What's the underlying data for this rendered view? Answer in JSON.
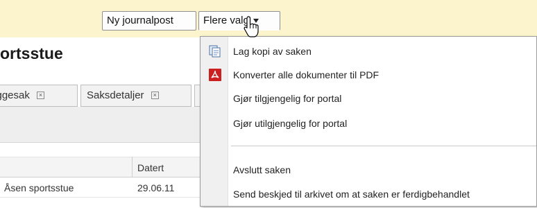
{
  "toolbar": {
    "new_entry": "Ny journalpost",
    "more_options": "Flere valg"
  },
  "page": {
    "title": "ortsstue"
  },
  "tabs": [
    {
      "label": "yggesak"
    },
    {
      "label": "Saksdetaljer"
    },
    {
      "label": ""
    }
  ],
  "grid": {
    "columns": [
      "",
      "Datert"
    ],
    "rows": [
      {
        "title": "Åsen sportsstue",
        "date": "29.06.11"
      }
    ]
  },
  "menu": {
    "items": [
      {
        "label": "Lag kopi av saken",
        "icon": "copy-document-icon"
      },
      {
        "label": "Konverter alle dokumenter til PDF",
        "icon": "pdf-icon"
      },
      {
        "label": "Gjør tilgjengelig for portal",
        "icon": ""
      },
      {
        "label": "Gjør utilgjengelig for portal",
        "icon": ""
      },
      {
        "label": "Avslutt saken",
        "icon": ""
      },
      {
        "label": "Send beskjed til arkivet om at saken er ferdigbehandlet",
        "icon": ""
      }
    ]
  },
  "colors": {
    "toolbar_bg": "#fbf4cd",
    "pdf_red": "#cc1f1f"
  }
}
